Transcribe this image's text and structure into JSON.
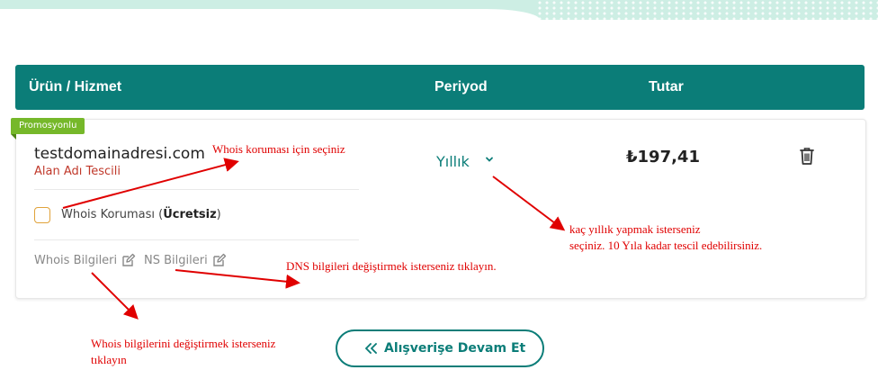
{
  "header": {
    "product_label": "Ürün / Hizmet",
    "period_label": "Periyod",
    "amount_label": "Tutar"
  },
  "item": {
    "badge": "Promosyonlu",
    "domain": "testdomainadresi.com",
    "subtitle": "Alan Adı Tescili",
    "whois_label": "Whois Koruması (",
    "whois_free": "Ücretsiz",
    "whois_close": ")",
    "whois_info_link": "Whois Bilgileri",
    "ns_info_link": "NS Bilgileri",
    "period_value": "Yıllık",
    "price": "₺197,41"
  },
  "footer": {
    "continue_label": "Alışverişe Devam Et"
  },
  "annotations": {
    "whois_protection": "Whois koruması için seçiniz",
    "period_line1": "kaç yıllık yapmak isterseniz",
    "period_line2": "seçiniz. 10 Yıla kadar tescil edebilirsiniz.",
    "dns": "DNS bilgileri değiştirmek isterseniz tıklayın.",
    "whois_info_line1": "Whois bilgilerini değiştirmek isterseniz",
    "whois_info_line2": "tıklayın"
  },
  "colors": {
    "accent": "#0b7d78",
    "promo": "#76b82a",
    "annotation": "#e00000"
  }
}
